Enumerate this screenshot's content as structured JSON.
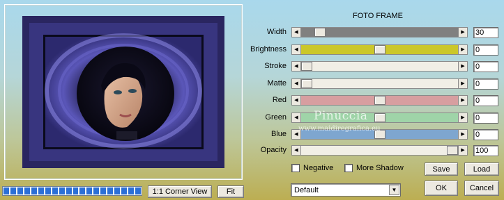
{
  "panel": {
    "title": "FOTO FRAME"
  },
  "sliders": [
    {
      "key": "width",
      "label": "Width",
      "value": "30",
      "position": 0.09,
      "track_color": "#808080"
    },
    {
      "key": "brightness",
      "label": "Brightness",
      "value": "0",
      "position": 0.5,
      "track_color": "#cbc72a"
    },
    {
      "key": "stroke",
      "label": "Stroke",
      "value": "0",
      "position": 0.0,
      "track_color": "#f1efe6"
    },
    {
      "key": "matte",
      "label": "Matte",
      "value": "0",
      "position": 0.0,
      "track_color": "#f1efe6"
    },
    {
      "key": "red",
      "label": "Red",
      "value": "0",
      "position": 0.5,
      "track_color": "#d79ea0"
    },
    {
      "key": "green",
      "label": "Green",
      "value": "0",
      "position": 0.5,
      "track_color": "#9fd4a8"
    },
    {
      "key": "blue",
      "label": "Blue",
      "value": "0",
      "position": 0.5,
      "track_color": "#7ea6cf"
    },
    {
      "key": "opacity",
      "label": "Opacity",
      "value": "100",
      "position": 1.0,
      "track_color": "#f1efe6"
    }
  ],
  "checkboxes": {
    "negative": "Negative",
    "more_shadow": "More Shadow"
  },
  "buttons": {
    "save": "Save",
    "load": "Load",
    "ok": "OK",
    "cancel": "Cancel",
    "corner_view": "1:1 Corner View",
    "fit": "Fit"
  },
  "preset": {
    "selected": "Default"
  },
  "progress": {
    "fraction": 1.0
  },
  "watermark": {
    "name": "Pinuccia",
    "site": "www.maidiregrafica.eu"
  },
  "icons": {
    "left_arrow": "◀",
    "right_arrow": "▶",
    "dropdown": "▼"
  }
}
